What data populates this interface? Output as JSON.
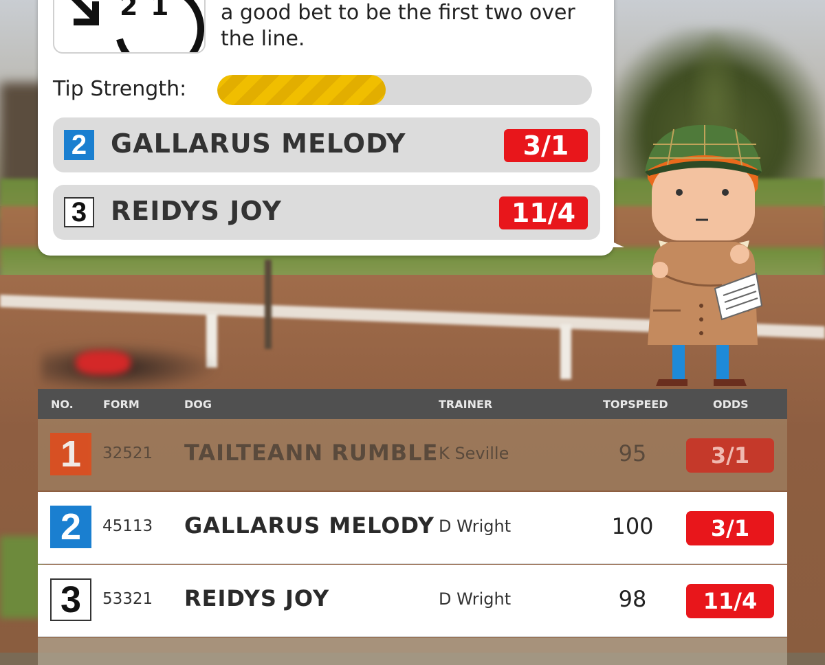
{
  "bubble": {
    "text": "a good bet to be the first two over the line.",
    "strength_label": "Tip Strength:",
    "strength_value": 0.45,
    "icon": "forecast-2-1-icon",
    "tips": [
      {
        "number": "2",
        "name": "GALLARUS MELODY",
        "odds": "3/1",
        "trap_color": "#1a7fd0"
      },
      {
        "number": "3",
        "name": "REIDYS JOY",
        "odds": "11/4",
        "trap_color": "#ffffff"
      }
    ]
  },
  "table": {
    "headers": {
      "no": "NO.",
      "form": "FORM",
      "dog": "DOG",
      "trainer": "TRAINER",
      "topspeed": "TOPSPEED",
      "odds": "ODDS"
    },
    "rows": [
      {
        "number": "1",
        "form": "32521",
        "dog": "TAILTEANN RUMBLE",
        "trainer": "K Seville",
        "topspeed": "95",
        "odds": "3/1",
        "trap_color": "#e24a1a",
        "faded": true
      },
      {
        "number": "2",
        "form": "45113",
        "dog": "GALLARUS MELODY",
        "trainer": "D Wright",
        "topspeed": "100",
        "odds": "3/1",
        "trap_color": "#1a7fd0",
        "faded": false
      },
      {
        "number": "3",
        "form": "53321",
        "dog": "REIDYS JOY",
        "trainer": "D Wright",
        "topspeed": "98",
        "odds": "11/4",
        "trap_color": "#ffffff",
        "faded": false
      }
    ]
  },
  "character": {
    "icon": "tipster-character-icon"
  },
  "colors": {
    "odds_red": "#e8161b",
    "strength_yellow": "#f0be00",
    "header_gray": "#505050"
  }
}
